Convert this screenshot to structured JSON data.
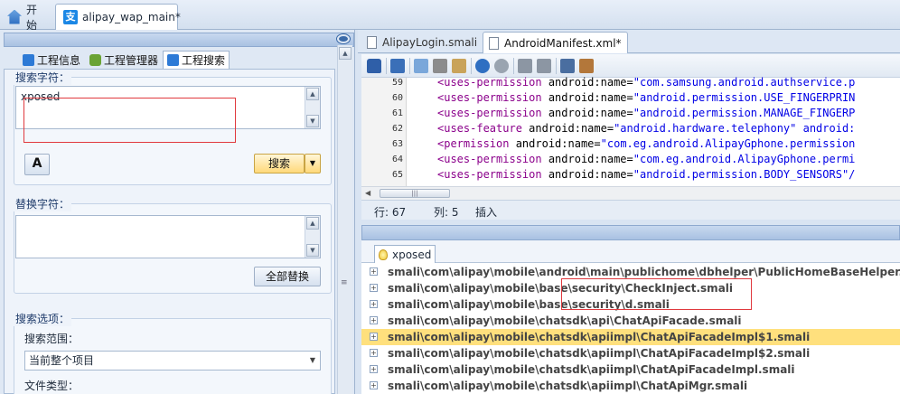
{
  "top_tabs": [
    {
      "label": "开始",
      "icon": "home-icon"
    },
    {
      "label": "alipay_wap_main*",
      "icon": "alipay-icon"
    }
  ],
  "left_panel": {
    "tabs": [
      {
        "label": "工程信息",
        "icon": "info-icon"
      },
      {
        "label": "工程管理器",
        "icon": "android-icon"
      },
      {
        "label": "工程搜索",
        "icon": "search-icon"
      }
    ],
    "search_group_label": "搜索字符：",
    "search_value": "xposed",
    "search_button": "搜索",
    "replace_group_label": "替换字符：",
    "replace_value": "",
    "replace_all_button": "全部替换",
    "options_group_label": "搜索选项：",
    "scope_label": "搜索范围：",
    "scope_value": "当前整个项目",
    "filetype_label": "文件类型："
  },
  "editor": {
    "tabs": [
      {
        "label": "AlipayLogin.smali",
        "active": false
      },
      {
        "label": "AndroidManifest.xml*",
        "active": true
      }
    ],
    "lines": [
      {
        "num": "59",
        "tag": "<uses-permission",
        "attr": " android:name=",
        "val": "\"com.samsung.android.authservice.p"
      },
      {
        "num": "60",
        "tag": "<uses-permission",
        "attr": " android:name=",
        "val": "\"android.permission.USE_FINGERPRIN"
      },
      {
        "num": "61",
        "tag": "<uses-permission",
        "attr": " android:name=",
        "val": "\"android.permission.MANAGE_FINGERP"
      },
      {
        "num": "62",
        "tag": "<uses-feature",
        "attr": " android:name=",
        "val": "\"android.hardware.telephony\" android:"
      },
      {
        "num": "63",
        "tag": "<permission",
        "attr": " android:name=",
        "val": "\"com.eg.android.AlipayGphone.permission"
      },
      {
        "num": "64",
        "tag": "<uses-permission",
        "attr": " android:name=",
        "val": "\"com.eg.android.AlipayGphone.permi"
      },
      {
        "num": "65",
        "tag": "<uses-permission",
        "attr": " android:name=",
        "val": "\"android.permission.BODY_SENSORS\"/"
      }
    ],
    "status": {
      "row_label": "行: 67",
      "col_label": "列: 5",
      "mode": "插入"
    }
  },
  "results": {
    "tab_label": "xposed",
    "items": [
      {
        "path": "smali\\com\\alipay\\mobile\\android\\main\\publichome\\dbhelper\\PublicHomeBaseHelper.sma",
        "selected": false
      },
      {
        "path": "smali\\com\\alipay\\mobile\\base\\security\\CheckInject.smali",
        "selected": false
      },
      {
        "path": "smali\\com\\alipay\\mobile\\base\\security\\d.smali",
        "selected": false
      },
      {
        "path": "smali\\com\\alipay\\mobile\\chatsdk\\api\\ChatApiFacade.smali",
        "selected": false
      },
      {
        "path": "smali\\com\\alipay\\mobile\\chatsdk\\apiimpl\\ChatApiFacadeImpl$1.smali",
        "selected": true
      },
      {
        "path": "smali\\com\\alipay\\mobile\\chatsdk\\apiimpl\\ChatApiFacadeImpl$2.smali",
        "selected": false
      },
      {
        "path": "smali\\com\\alipay\\mobile\\chatsdk\\apiimpl\\ChatApiFacadeImpl.smali",
        "selected": false
      },
      {
        "path": "smali\\com\\alipay\\mobile\\chatsdk\\apiimpl\\ChatApiMgr.smali",
        "selected": false
      }
    ]
  },
  "colors": {
    "accent": "#1b87e5",
    "selection": "#ffe07d",
    "highlight_box": "#e0393e"
  }
}
